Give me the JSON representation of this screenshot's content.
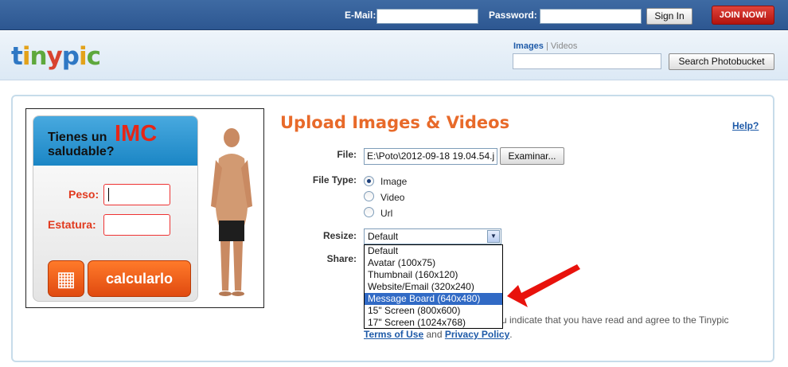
{
  "topbar": {
    "email_label": "E-Mail:",
    "email_value": "",
    "password_label": "Password:",
    "password_value": "",
    "signin_label": "Sign In",
    "join_label": "JOIN NOW!"
  },
  "header": {
    "logo_letters": [
      "t",
      "i",
      "n",
      "y",
      "p",
      "i",
      "c"
    ],
    "tab_images": "Images",
    "tab_separator": "|",
    "tab_videos": "Videos",
    "search_value": "",
    "search_button": "Search Photobucket"
  },
  "ad": {
    "question_line1": "Tienes un",
    "imc": "IMC",
    "question_line2": "saludable?",
    "peso_label": "Peso:",
    "estatura_label": "Estatura:",
    "calc_icon": "calculator-icon",
    "calc_label": "calcularlo"
  },
  "upload": {
    "title": "Upload Images & Videos",
    "help": "Help?",
    "file_label": "File:",
    "file_value": "E:\\Poto\\2012-09-18 19.04.54.j",
    "browse_label": "Examinar...",
    "filetype_label": "File Type:",
    "filetypes": [
      {
        "label": "Image",
        "checked": true
      },
      {
        "label": "Video",
        "checked": false
      },
      {
        "label": "Url",
        "checked": false
      }
    ],
    "resize_label": "Resize:",
    "resize_value": "Default",
    "resize_options": [
      "Default",
      "Avatar (100x75)",
      "Thumbnail (160x120)",
      "Website/Email (320x240)",
      "Message Board (640x480)",
      "15\" Screen (800x600)",
      "17\" Screen (1024x768)"
    ],
    "resize_highlighted": "Message Board (640x480)",
    "share_label": "Share:",
    "terms_text": "u indicate that you have read and agree to the Tinypic",
    "terms_link": "Terms of Use",
    "terms_and": "and",
    "privacy_link": "Privacy Policy",
    "terms_end": "."
  },
  "colors": {
    "topbar": "#2d5791",
    "title": "#e86a2a",
    "link": "#1e5aa8",
    "join": "#c21a13",
    "arrow": "#e8120c",
    "selection": "#316ac5"
  }
}
